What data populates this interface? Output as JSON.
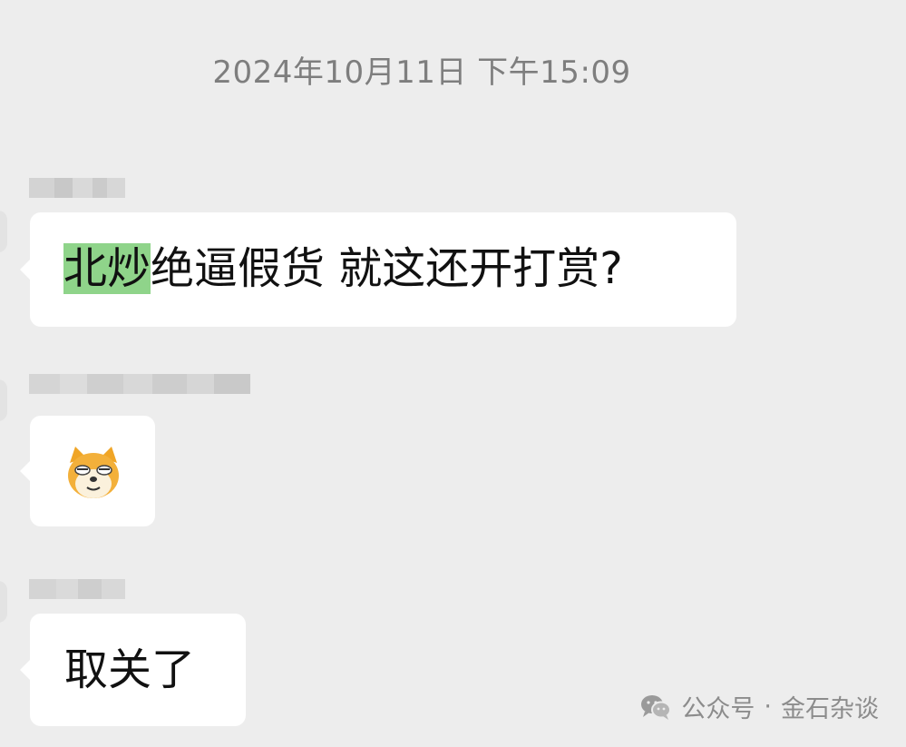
{
  "chat": {
    "timestamp": "2024年10月11日 下午15:09",
    "messages": [
      {
        "highlight": "北炒",
        "text": "绝逼假货  就这还开打赏?"
      },
      {
        "sticker": "doge-sticker"
      },
      {
        "text": "取关了"
      }
    ]
  },
  "watermark": {
    "account_type": "公众号",
    "separator": "·",
    "account_name": "金石杂谈"
  },
  "colors": {
    "background": "#ededed",
    "bubble": "#ffffff",
    "highlight": "#8fd48a"
  }
}
